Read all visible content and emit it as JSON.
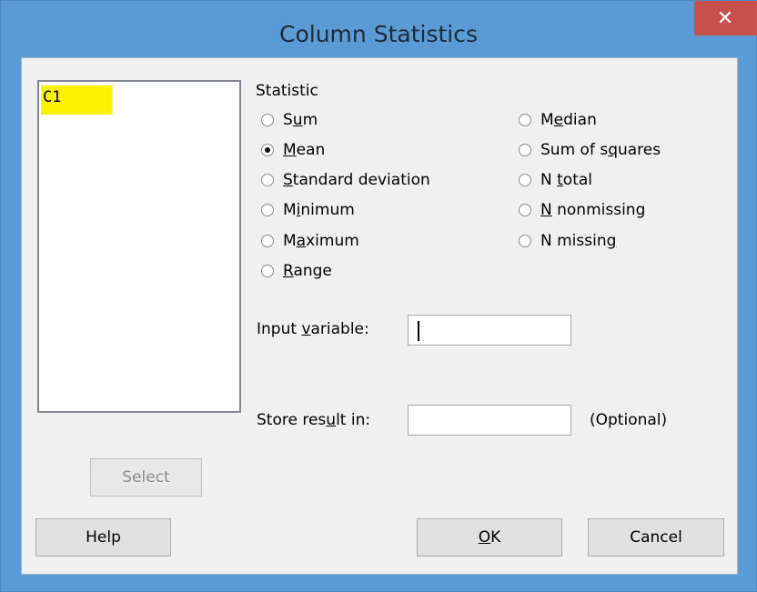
{
  "window": {
    "title": "Column Statistics",
    "close_glyph": "✕"
  },
  "variables": {
    "items": [
      "C1"
    ],
    "highlight_color": "#fff200"
  },
  "statistic": {
    "label": "Statistic",
    "options_left": [
      {
        "pre": "S",
        "key": "u",
        "post": "m",
        "checked": false
      },
      {
        "pre": "",
        "key": "M",
        "post": "ean",
        "checked": true
      },
      {
        "pre": "",
        "key": "S",
        "post": "tandard deviation",
        "checked": false
      },
      {
        "pre": "M",
        "key": "i",
        "post": "nimum",
        "checked": false
      },
      {
        "pre": "M",
        "key": "a",
        "post": "ximum",
        "checked": false
      },
      {
        "pre": "",
        "key": "R",
        "post": "ange",
        "checked": false
      }
    ],
    "options_right": [
      {
        "pre": "M",
        "key": "e",
        "post": "dian",
        "checked": false
      },
      {
        "pre": "Sum of s",
        "key": "q",
        "post": "uares",
        "checked": false
      },
      {
        "pre": "N ",
        "key": "t",
        "post": "otal",
        "checked": false
      },
      {
        "pre": "",
        "key": "N",
        "post": " nonmissing",
        "checked": false
      },
      {
        "pre": "N missin",
        "key": "g",
        "post": "",
        "checked": false
      }
    ]
  },
  "input_variable": {
    "label_pre": "Input ",
    "label_key": "v",
    "label_post": "ariable:",
    "value": ""
  },
  "store_result": {
    "label_pre": "Store res",
    "label_key": "u",
    "label_post": "lt in:",
    "value": "",
    "optional": "(Optional)"
  },
  "buttons": {
    "select": "Select",
    "help": "Help",
    "ok_key": "O",
    "ok_post": "K",
    "cancel": "Cancel"
  }
}
